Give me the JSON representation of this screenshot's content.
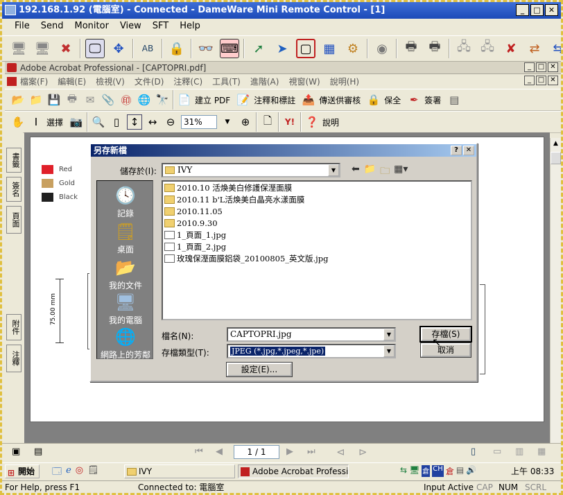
{
  "window": {
    "title": "192.168.1.92 (電腦室) - Connected - DameWare Mini Remote Control - [1]"
  },
  "dw_menu": [
    "File",
    "Send",
    "Monitor",
    "View",
    "SFT",
    "Help"
  ],
  "acrobat": {
    "title": "Adobe Acrobat Professional - [CAPTOPRI.pdf]",
    "menu": [
      "檔案(F)",
      "編輯(E)",
      "檢視(V)",
      "文件(D)",
      "注釋(C)",
      "工具(T)",
      "進階(A)",
      "視窗(W)",
      "說明(H)"
    ],
    "toolbar1": {
      "create_pdf": "建立 PDF",
      "comment": "注釋和標註",
      "review": "傳送供審核",
      "secure": "保全",
      "sign": "簽署"
    },
    "toolbar2": {
      "select": "選擇",
      "zoom": "31%",
      "help": "說明"
    },
    "left_tabs": {
      "bookmarks": "書籤",
      "signatures": "簽名",
      "pages": "頁面",
      "attachments": "附件",
      "comments": "注釋"
    },
    "page_nav": "1 / 1"
  },
  "document": {
    "legend": [
      {
        "label": "Red",
        "color": "#e0202a"
      },
      {
        "label": "Gold",
        "color": "#c8a060"
      },
      {
        "label": "Black",
        "color": "#202020"
      }
    ],
    "dimension": "75.00 mm"
  },
  "dialog": {
    "title": "另存新檔",
    "save_in_label": "儲存於(I):",
    "save_in_value": "IVY",
    "places": [
      "記錄",
      "桌面",
      "我的文件",
      "我的電腦",
      "網路上的芳鄰"
    ],
    "files": [
      {
        "name": "2010.10 活煥美白修護保溼面膜",
        "type": "folder"
      },
      {
        "name": "2010.11 b'L活煥美白晶亮水漾面膜",
        "type": "folder"
      },
      {
        "name": "2010.11.05",
        "type": "folder"
      },
      {
        "name": "2010.9.30",
        "type": "folder"
      },
      {
        "name": "1_頁面_1.jpg",
        "type": "jpg"
      },
      {
        "name": "1_頁面_2.jpg",
        "type": "jpg"
      },
      {
        "name": "玫瑰保溼面膜鋁袋_20100805_英文版.jpg",
        "type": "jpg"
      }
    ],
    "filename_label": "檔名(N):",
    "filename_value": "CAPTOPRI.jpg",
    "filetype_label": "存檔類型(T):",
    "filetype_value": "JPEG (*.jpg,*.jpeg,*.jpe)",
    "save_button": "存檔(S)",
    "cancel_button": "取消",
    "settings_button": "設定(E)..."
  },
  "taskbar": {
    "start": "開始",
    "tasks": [
      "IVY",
      "Adobe Acrobat Professiona..."
    ],
    "clock": "上午 08:33"
  },
  "status": {
    "help": "For Help, press F1",
    "connected": "Connected to: 電腦室",
    "input": "Input Active",
    "cap": "CAP",
    "num": "NUM",
    "scrl": "SCRL"
  }
}
